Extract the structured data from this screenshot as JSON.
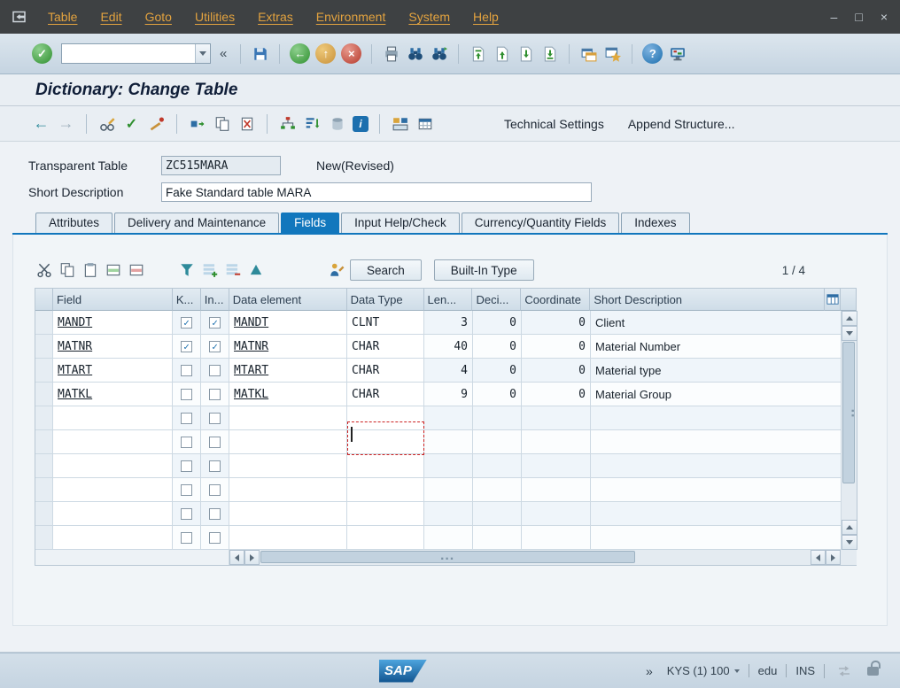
{
  "menubar": {
    "items": [
      "Table",
      "Edit",
      "Goto",
      "Utilities",
      "Extras",
      "Environment",
      "System",
      "Help"
    ]
  },
  "window_controls": {
    "minimize": "–",
    "restore": "□",
    "close": "×"
  },
  "toolbar": {
    "command_value": "",
    "collapse_glyph": "«"
  },
  "screen_title": "Dictionary: Change Table",
  "app_toolbar": {
    "technical_settings": "Technical Settings",
    "append_structure": "Append Structure..."
  },
  "form": {
    "table_label": "Transparent Table",
    "table_value": "ZC515MARA",
    "table_status": "New(Revised)",
    "description_label": "Short Description",
    "description_value": "Fake Standard table MARA"
  },
  "tabs": [
    {
      "label": "Attributes",
      "active": false
    },
    {
      "label": "Delivery and Maintenance",
      "active": false
    },
    {
      "label": "Fields",
      "active": true
    },
    {
      "label": "Input Help/Check",
      "active": false
    },
    {
      "label": "Currency/Quantity Fields",
      "active": false
    },
    {
      "label": "Indexes",
      "active": false
    }
  ],
  "grid_toolbar": {
    "search_label": "Search",
    "built_in_type_label": "Built-In Type",
    "page_indicator": "1 / 4"
  },
  "grid": {
    "columns": [
      "Field",
      "K...",
      "In...",
      "Data element",
      "Data Type",
      "Len...",
      "Deci...",
      "Coordinate",
      "Short Description"
    ],
    "rows": [
      {
        "field": "MANDT",
        "key": true,
        "initial": true,
        "data_element": "MANDT",
        "data_type": "CLNT",
        "length": "3",
        "decimals": "0",
        "coordinate": "0",
        "short_description": "Client"
      },
      {
        "field": "MATNR",
        "key": true,
        "initial": true,
        "data_element": "MATNR",
        "data_type": "CHAR",
        "length": "40",
        "decimals": "0",
        "coordinate": "0",
        "short_description": "Material Number"
      },
      {
        "field": "MTART",
        "key": false,
        "initial": false,
        "data_element": "MTART",
        "data_type": "CHAR",
        "length": "4",
        "decimals": "0",
        "coordinate": "0",
        "short_description": "Material type"
      },
      {
        "field": "MATKL",
        "key": false,
        "initial": false,
        "data_element": "MATKL",
        "data_type": "CHAR",
        "length": "9",
        "decimals": "0",
        "coordinate": "0",
        "short_description": "Material Group"
      }
    ],
    "empty_rows": 6
  },
  "statusbar": {
    "logo": "SAP",
    "chevron": "»",
    "system": "KYS (1) 100",
    "user": "edu",
    "mode": "INS"
  },
  "colors": {
    "accent_blue": "#1277bd",
    "menubar_text": "#e2a23f",
    "selection_red": "#cc2222"
  }
}
